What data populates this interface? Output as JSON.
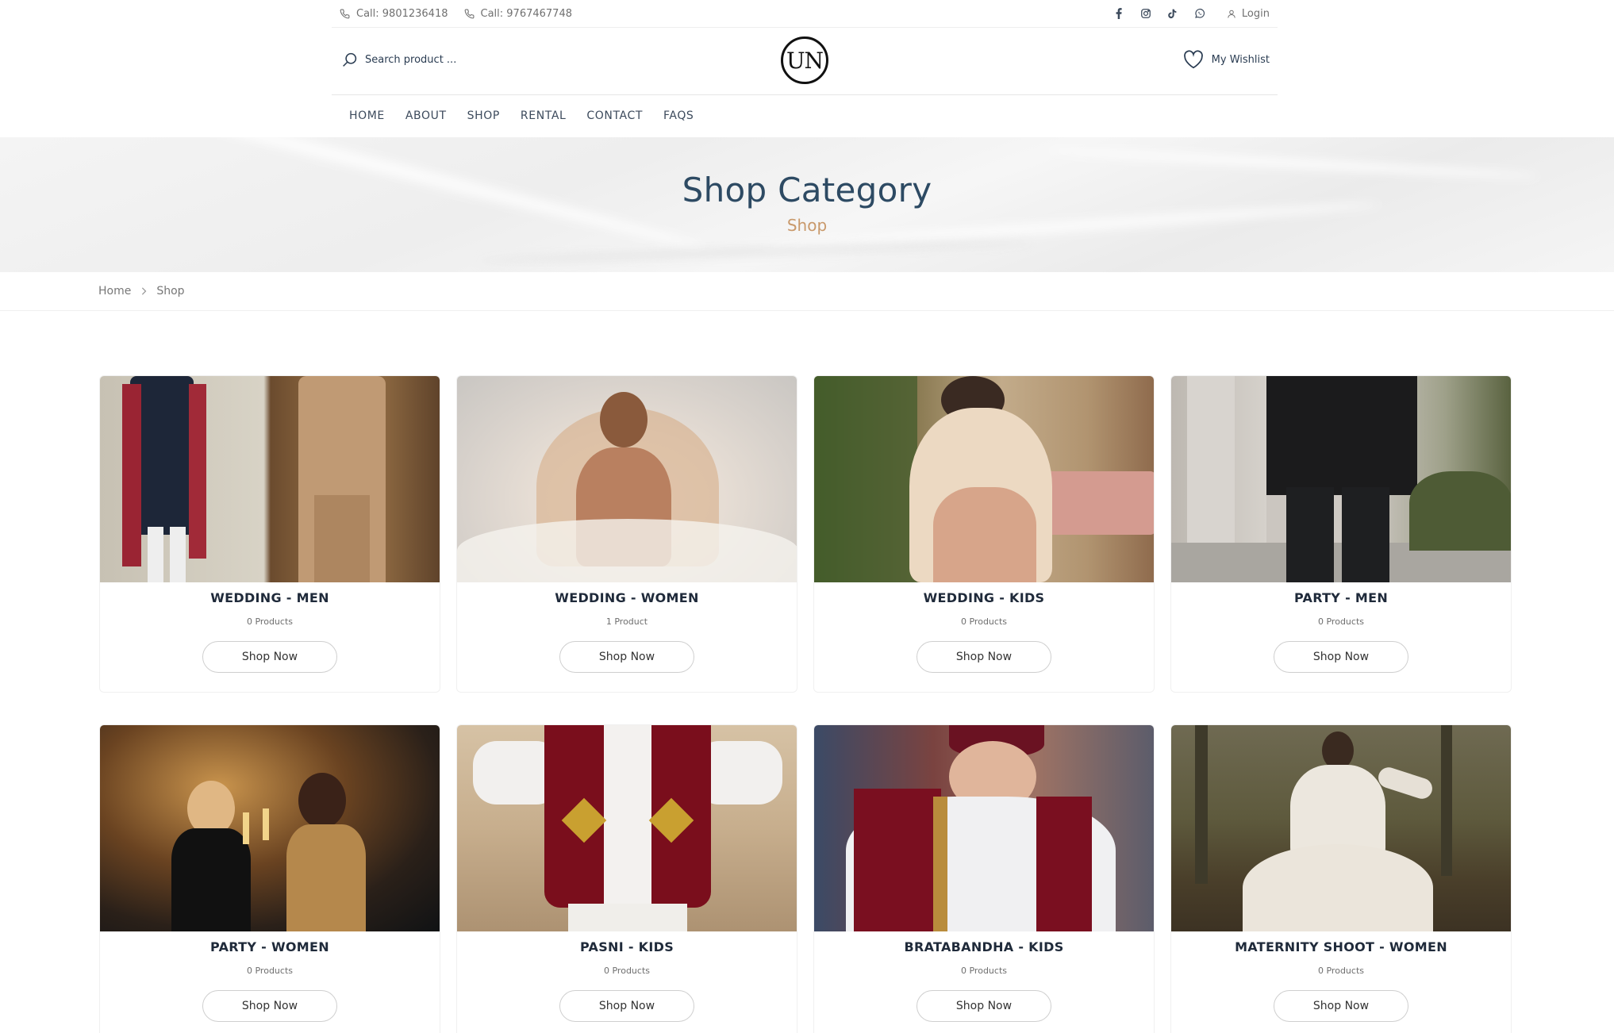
{
  "topbar": {
    "phone1": "Call: 9801236418",
    "phone2": "Call: 9767467748",
    "social_icons": [
      "facebook-icon",
      "instagram-icon",
      "tiktok-icon",
      "whatsapp-icon"
    ],
    "login_label": "Login"
  },
  "header": {
    "search_placeholder": "Search product ...",
    "logo_text": "UN",
    "wishlist_label": "My Wishlist"
  },
  "nav": {
    "items": [
      "HOME",
      "ABOUT",
      "SHOP",
      "RENTAL",
      "CONTACT",
      "FAQS"
    ]
  },
  "hero": {
    "title": "Shop Category",
    "subtitle": "Shop"
  },
  "breadcrumb": {
    "home": "Home",
    "current": "Shop"
  },
  "categories": [
    {
      "name": "WEDDING - MEN",
      "count": "0 Products",
      "button": "Shop Now"
    },
    {
      "name": "WEDDING - WOMEN",
      "count": "1 Product",
      "button": "Shop Now"
    },
    {
      "name": "WEDDING - KIDS",
      "count": "0 Products",
      "button": "Shop Now"
    },
    {
      "name": "PARTY - MEN",
      "count": "0 Products",
      "button": "Shop Now"
    },
    {
      "name": "PARTY - WOMEN",
      "count": "0 Products",
      "button": "Shop Now"
    },
    {
      "name": "PASNI - KIDS",
      "count": "0 Products",
      "button": "Shop Now"
    },
    {
      "name": "BRATABANDHA - KIDS",
      "count": "0 Products",
      "button": "Shop Now"
    },
    {
      "name": "MATERNITY SHOOT - WOMEN",
      "count": "0 Products",
      "button": "Shop Now"
    }
  ],
  "colors": {
    "title_blue": "#2d4a63",
    "accent_gold": "#c9996b",
    "text_dark": "#1f2a3a"
  }
}
